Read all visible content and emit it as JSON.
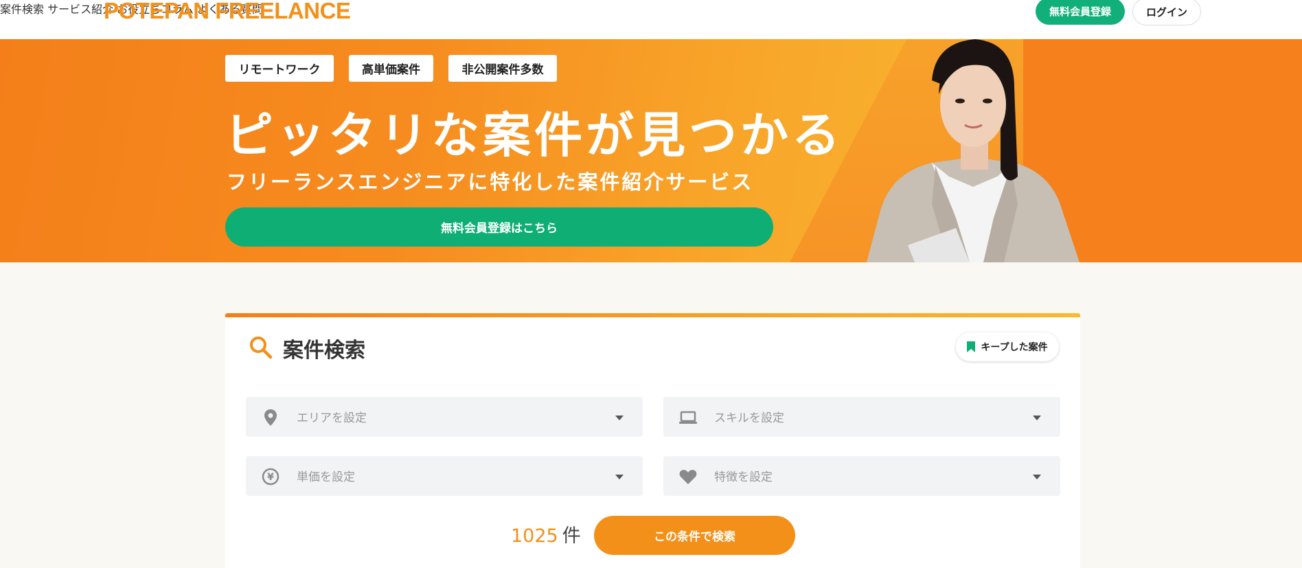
{
  "header": {
    "logo": "POTEPAN FREELANCE",
    "nav": [
      "案件検索",
      "サービス紹介",
      "お役立ちコラム",
      "よくある質問"
    ],
    "register_label": "無料会員登録",
    "login_label": "ログイン"
  },
  "hero": {
    "tags": [
      "リモートワーク",
      "高単価案件",
      "非公開案件多数"
    ],
    "title": "ピッタリな案件が見つかる",
    "subtitle": "フリーランスエンジニアに特化した案件紹介サービス",
    "cta_label": "無料会員登録はこちら"
  },
  "search": {
    "title": "案件検索",
    "keep_label": "キープした案件",
    "fields": [
      {
        "label": "エリアを設定",
        "icon": "map-pin-icon"
      },
      {
        "label": "スキルを設定",
        "icon": "laptop-icon"
      },
      {
        "label": "単価を設定",
        "icon": "yen-icon"
      },
      {
        "label": "特徴を設定",
        "icon": "heart-icon"
      }
    ],
    "count": "1025",
    "count_unit": "件",
    "submit_label": "この条件で検索"
  },
  "colors": {
    "brand_orange": "#f39019",
    "green": "#0eae74",
    "hero_orange": "#f6801b"
  }
}
